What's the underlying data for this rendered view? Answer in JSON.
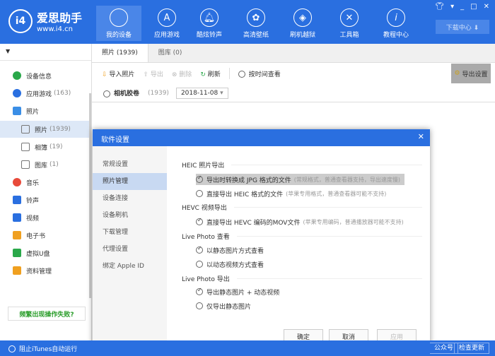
{
  "header": {
    "logo_text": "爱思助手",
    "logo_url": "www.i4.cn",
    "logo_mark": "i4",
    "nav": [
      {
        "label": "我的设备",
        "icon": "apple-icon"
      },
      {
        "label": "应用游戏",
        "icon": "appstore-icon"
      },
      {
        "label": "酷炫铃声",
        "icon": "bell-icon"
      },
      {
        "label": "高清壁纸",
        "icon": "flower-icon"
      },
      {
        "label": "刷机越狱",
        "icon": "dropbox-icon"
      },
      {
        "label": "工具箱",
        "icon": "tools-icon"
      },
      {
        "label": "教程中心",
        "icon": "info-icon"
      }
    ],
    "download_center": "下载中心 ⬇"
  },
  "sidebar": {
    "items": [
      {
        "label": "设备信息",
        "count": ""
      },
      {
        "label": "应用游戏",
        "count": "(163)"
      },
      {
        "label": "照片",
        "count": ""
      },
      {
        "label": "照片",
        "count": "(1939)"
      },
      {
        "label": "相簿",
        "count": "(19)"
      },
      {
        "label": "图库",
        "count": "(1)"
      },
      {
        "label": "音乐",
        "count": ""
      },
      {
        "label": "铃声",
        "count": ""
      },
      {
        "label": "视频",
        "count": ""
      },
      {
        "label": "电子书",
        "count": ""
      },
      {
        "label": "虚拟U盘",
        "count": ""
      },
      {
        "label": "资料管理",
        "count": ""
      }
    ],
    "fail_button": "频繁出现操作失败?"
  },
  "main": {
    "tabs": [
      "照片 (1939)",
      "图库 (0)"
    ],
    "toolbar": {
      "import": "导入照片",
      "export": "导出",
      "delete": "删除",
      "refresh": "刷新",
      "by_time": "按时间查看",
      "export_settings": "导出设置"
    },
    "camera_roll": "相机胶卷",
    "camera_roll_count": "(1939)",
    "date": "2018-11-08"
  },
  "dialog": {
    "title": "软件设置",
    "nav": [
      "常规设置",
      "照片管理",
      "设备连接",
      "设备刷机",
      "下载管理",
      "代理设置",
      "绑定 Apple ID"
    ],
    "sections": [
      {
        "title": "HEIC 照片导出",
        "options": [
          {
            "label": "导出时转换成 JPG 格式的文件",
            "note": "(常规格式，普通查看器支持，导出速度慢)",
            "checked": true
          },
          {
            "label": "直接导出 HEIC 格式的文件",
            "note": "(苹果专用格式，普通查看器可能不支持)",
            "checked": false
          }
        ]
      },
      {
        "title": "HEVC 视频导出",
        "options": [
          {
            "label": "直接导出 HEVC 编码的MOV文件",
            "note": "(苹果专用编码，普通播放器可能不支持)",
            "checked": true
          }
        ]
      },
      {
        "title": "Live Photo 查看",
        "options": [
          {
            "label": "以静态图片方式查看",
            "note": "",
            "checked": true
          },
          {
            "label": "以动态视频方式查看",
            "note": "",
            "checked": false
          }
        ]
      },
      {
        "title": "Live Photo 导出",
        "options": [
          {
            "label": "导出静态图片 + 动态视频",
            "note": "",
            "checked": true
          },
          {
            "label": "仅导出静态图片",
            "note": "",
            "checked": false
          }
        ]
      }
    ],
    "ok": "确定",
    "cancel": "取消",
    "apply": "应用"
  },
  "footer": {
    "block_itunes": "阻止iTunes自动运行",
    "wechat": "公众号",
    "check_update": "检查更新"
  }
}
